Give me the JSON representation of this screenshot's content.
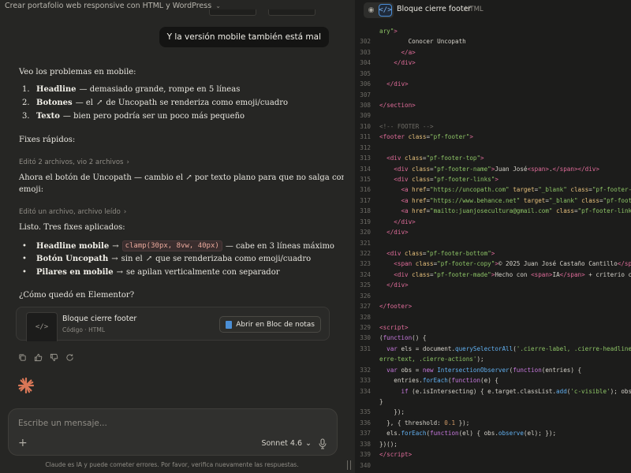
{
  "chat": {
    "title": "Crear portafolio web responsive con HTML y WordPress",
    "user_message": "Y la versión mobile también está mal",
    "intro": "Veo los problemas en mobile:",
    "problems": [
      {
        "num": "1.",
        "bold": "Headline",
        "text": " — demasiado grande, rompe en 5 líneas"
      },
      {
        "num": "2.",
        "bold": "Botones",
        "text_before": " — el ",
        "arrow": "↗",
        "text": " de Uncopath se renderiza como emoji/cuadro"
      },
      {
        "num": "3.",
        "bold": "Texto",
        "text": " — bien pero podría ser un poco más pequeño"
      }
    ],
    "fixes_heading": "Fixes rápidos:",
    "meta_1": "Editó 2 archivos, vio 2 archivos",
    "uncopath_line1_before": "Ahora el botón de Uncopath — cambio el ",
    "uncopath_arrow": "↗",
    "uncopath_line1_after": " por texto plano para que no salga como",
    "uncopath_line2": "emoji:",
    "meta_2": "Editó un archivo, archivo leído",
    "applied_heading": "Listo. Tres fixes aplicados:",
    "applied": [
      {
        "bold": "Headline mobile",
        "arrow": "→",
        "code": "clamp(30px, 8vw, 40px)",
        "text": " — cabe en 3 líneas máximo"
      },
      {
        "bold": "Botón Uncopath",
        "arrow": "→",
        "text_before": " sin el ",
        "inline_arrow": "↗",
        "text": " que se renderizaba como emoji/cuadro"
      },
      {
        "bold": "Pilares en mobile",
        "arrow": "→",
        "text": " se apilan verticalmente con separador"
      }
    ],
    "question": "¿Cómo quedó en Elementor?",
    "artifact": {
      "thumb_glyph": "</>",
      "name": "Bloque cierre footer",
      "kind": "Código · HTML",
      "open_label": "Abrir en Bloc de notas"
    },
    "composer": {
      "placeholder": "Escribe un mensaje...",
      "plus": "+",
      "model": "Sonnet 4.6",
      "model_chevron": "⌄"
    },
    "disclaimer": "Claude es IA y puede cometer errores. Por favor, verifica nuevamente las respuestas.",
    "chevron": "⌄",
    "meta_chevron": "›"
  },
  "code_panel": {
    "preview_icon": "◉",
    "code_icon": "</>",
    "title": "Bloque cierre footer",
    "type": "HTML",
    "lines": [
      {
        "n": "",
        "html": "<span class='st'>ary\"</span><span class='tg'>&gt;</span>"
      },
      {
        "n": "302",
        "html": "        Conocer Uncopath"
      },
      {
        "n": "303",
        "html": "      <span class='tg'>&lt;/a&gt;</span>"
      },
      {
        "n": "304",
        "html": "    <span class='tg'>&lt;/div&gt;</span>"
      },
      {
        "n": "305",
        "html": ""
      },
      {
        "n": "306",
        "html": "  <span class='tg'>&lt;/div&gt;</span>"
      },
      {
        "n": "307",
        "html": ""
      },
      {
        "n": "308",
        "html": "<span class='tg'>&lt;/section&gt;</span>"
      },
      {
        "n": "309",
        "html": ""
      },
      {
        "n": "310",
        "html": "<span class='cm'>&lt;!-- FOOTER --&gt;</span>"
      },
      {
        "n": "311",
        "html": "<span class='tg'>&lt;footer</span> <span class='at'>class</span>=<span class='st'>\"pf-footer\"</span><span class='tg'>&gt;</span>"
      },
      {
        "n": "312",
        "html": ""
      },
      {
        "n": "313",
        "html": "  <span class='tg'>&lt;div</span> <span class='at'>class</span>=<span class='st'>\"pf-footer-top\"</span><span class='tg'>&gt;</span>"
      },
      {
        "n": "314",
        "html": "    <span class='tg'>&lt;div</span> <span class='at'>class</span>=<span class='st'>\"pf-footer-name\"</span><span class='tg'>&gt;</span>Juan José<span class='tg'>&lt;span&gt;</span>.<span class='tg'>&lt;/span&gt;&lt;/div&gt;</span>"
      },
      {
        "n": "315",
        "html": "    <span class='tg'>&lt;div</span> <span class='at'>class</span>=<span class='st'>\"pf-footer-links\"</span><span class='tg'>&gt;</span>"
      },
      {
        "n": "316",
        "html": "      <span class='tg'>&lt;a</span> <span class='at'>href</span>=<span class='st'>\"https://uncopath.com\"</span> <span class='at'>target</span>=<span class='st'>\"_blank\"</span> <span class='at'>class</span>=<span class='st'>\"pf-footer-lin</span>"
      },
      {
        "n": "317",
        "html": "      <span class='tg'>&lt;a</span> <span class='at'>href</span>=<span class='st'>\"https://www.behance.net\"</span> <span class='at'>target</span>=<span class='st'>\"_blank\"</span> <span class='at'>class</span>=<span class='st'>\"pf-footer-</span>"
      },
      {
        "n": "318",
        "html": "      <span class='tg'>&lt;a</span> <span class='at'>href</span>=<span class='st'>\"mailto:juanjosecultura@gmail.com\"</span> <span class='at'>class</span>=<span class='st'>\"pf-footer-link\"</span><span class='tg'>&gt;</span>E"
      },
      {
        "n": "319",
        "html": "    <span class='tg'>&lt;/div&gt;</span>"
      },
      {
        "n": "320",
        "html": "  <span class='tg'>&lt;/div&gt;</span>"
      },
      {
        "n": "321",
        "html": ""
      },
      {
        "n": "322",
        "html": "  <span class='tg'>&lt;div</span> <span class='at'>class</span>=<span class='st'>\"pf-footer-bottom\"</span><span class='tg'>&gt;</span>"
      },
      {
        "n": "323",
        "html": "    <span class='tg'>&lt;span</span> <span class='at'>class</span>=<span class='st'>\"pf-footer-copy\"</span><span class='tg'>&gt;</span>© 2025 Juan José Castaño Cantillo<span class='tg'>&lt;/span&gt;</span>"
      },
      {
        "n": "324",
        "html": "    <span class='tg'>&lt;div</span> <span class='at'>class</span>=<span class='st'>\"pf-footer-made\"</span><span class='tg'>&gt;</span>Hecho con <span class='tg'>&lt;span&gt;</span>IA<span class='tg'>&lt;/span&gt;</span> + criterio crea"
      },
      {
        "n": "325",
        "html": "  <span class='tg'>&lt;/div&gt;</span>"
      },
      {
        "n": "326",
        "html": ""
      },
      {
        "n": "327",
        "html": "<span class='tg'>&lt;/footer&gt;</span>"
      },
      {
        "n": "328",
        "html": ""
      },
      {
        "n": "329",
        "html": "<span class='tg'>&lt;script&gt;</span>"
      },
      {
        "n": "330",
        "html": "(<span class='kw'>function</span>() {"
      },
      {
        "n": "331",
        "html": "  <span class='kw'>var</span> els = document.<span class='fn'>querySelectorAll</span>(<span class='st'>'.cierre-label, .cierre-headline, .</span>"
      },
      {
        "n": "",
        "html": "<span class='st'>erre-text, .cierre-actions'</span>);"
      },
      {
        "n": "332",
        "html": "  <span class='kw'>var</span> obs = <span class='kw'>new</span> <span class='fn'>IntersectionObserver</span>(<span class='kw'>function</span>(entries) {"
      },
      {
        "n": "333",
        "html": "    entries.<span class='fn'>forEach</span>(<span class='kw'>function</span>(e) {"
      },
      {
        "n": "334",
        "html": "      <span class='kw'>if</span> (e.isIntersecting) { e.target.classList.<span class='fn'>add</span>(<span class='st'>'c-visible'</span>); obs.un"
      },
      {
        "n": "",
        "html": "}"
      },
      {
        "n": "335",
        "html": "    });"
      },
      {
        "n": "336",
        "html": "  }, { threshold: <span class='nu'>0.1</span> });"
      },
      {
        "n": "337",
        "html": "  els.<span class='fn'>forEach</span>(<span class='kw'>function</span>(el) { obs.<span class='fn'>observe</span>(el); });"
      },
      {
        "n": "338",
        "html": "})();"
      },
      {
        "n": "339",
        "html": "<span class='tg'>&lt;/script&gt;</span>"
      },
      {
        "n": "340",
        "html": ""
      }
    ]
  }
}
